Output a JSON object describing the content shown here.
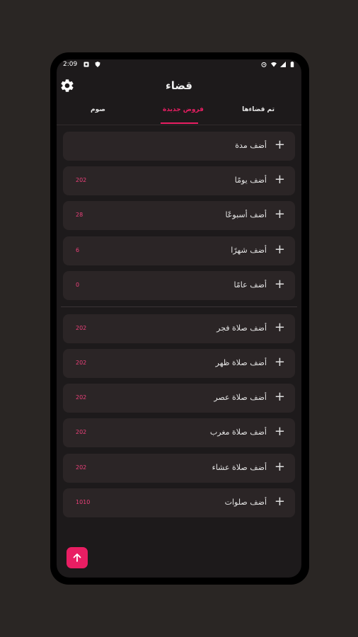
{
  "status": {
    "time": "2:09"
  },
  "app": {
    "title": "قضاء"
  },
  "tabs": [
    {
      "label": "تم قضاءها",
      "active": false
    },
    {
      "label": "فروض جديدة",
      "active": true
    },
    {
      "label": "صوم",
      "active": false
    }
  ],
  "cards": [
    {
      "label": "أضف مدة",
      "count": ""
    },
    {
      "label": "أضف يومًا",
      "count": "202"
    },
    {
      "label": "أضف أسبوعًا",
      "count": "28"
    },
    {
      "label": "أضف شهرًا",
      "count": "6"
    },
    {
      "label": "أضف عامًا",
      "count": "0"
    },
    {
      "label": "أضف صلاة فجر",
      "count": "202"
    },
    {
      "label": "أضف صلاة ظهر",
      "count": "202"
    },
    {
      "label": "أضف صلاة عصر",
      "count": "202"
    },
    {
      "label": "أضف صلاة مغرب",
      "count": "202"
    },
    {
      "label": "أضف صلاة عشاء",
      "count": "202"
    },
    {
      "label": "أضف صلوات",
      "count": "1010"
    }
  ],
  "icons": {
    "settings": "gear-icon",
    "add": "plus-icon",
    "fab": "arrow-up-icon"
  },
  "colors": {
    "accent": "#e91e63",
    "background": "#1d1a1b",
    "card": "#2b2526",
    "count_text": "#ec407a"
  }
}
